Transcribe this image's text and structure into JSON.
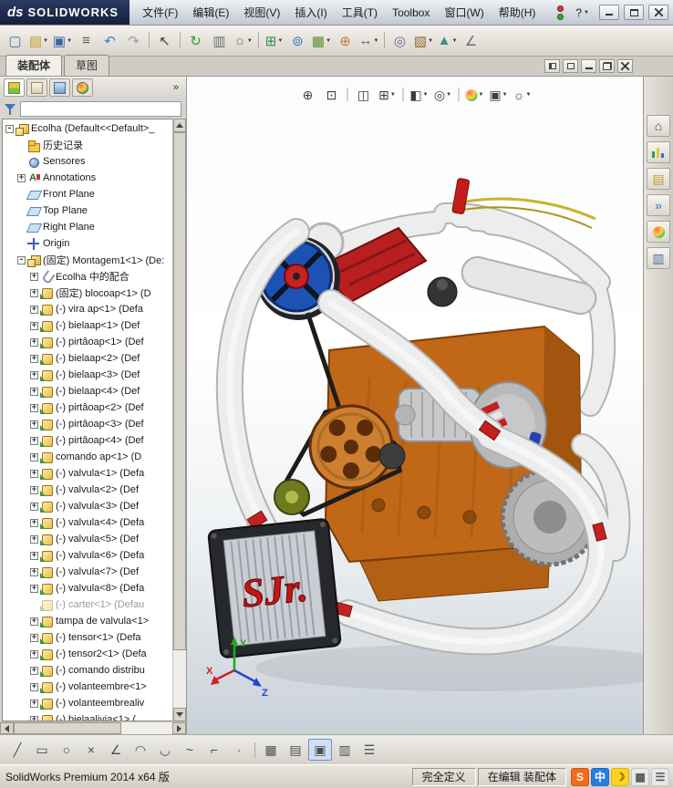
{
  "titlebar": {
    "logo_mark": "ds",
    "logo_text": "SOLIDWORKS",
    "menus": [
      "文件(F)",
      "编辑(E)",
      "视图(V)",
      "插入(I)",
      "工具(T)",
      "Toolbox",
      "窗口(W)",
      "帮助(H)"
    ],
    "help_label": "?"
  },
  "toolbar": {
    "items": [
      {
        "n": "new-icon",
        "g": "▢",
        "s": "color:#4a6fa5"
      },
      {
        "n": "open-icon",
        "g": "▤",
        "s": "color:#c89a2a",
        "caret": 1
      },
      {
        "n": "save-icon",
        "g": "▣",
        "s": "color:#3a62a8",
        "caret": 1
      },
      {
        "n": "print-icon",
        "g": "≡",
        "s": "color:#55585c"
      },
      {
        "n": "undo-icon",
        "g": "↶",
        "s": "color:#2f7fd0"
      },
      {
        "n": "redo-icon",
        "g": "↷",
        "s": "color:#9aa0a8"
      },
      {
        "sep": 1
      },
      {
        "n": "select-icon",
        "g": "↖",
        "s": "color:#3c3f44"
      },
      {
        "sep": 1
      },
      {
        "n": "rebuild-icon",
        "g": "↻",
        "s": "color:#2e9e3c"
      },
      {
        "n": "file-properties-icon",
        "g": "▥",
        "s": "color:#6a6d72"
      },
      {
        "n": "options-icon",
        "g": "☼",
        "s": "color:#707070",
        "caret": 1
      },
      {
        "sep": 1
      },
      {
        "n": "insert-components-icon",
        "g": "⊞",
        "s": "color:#2e8f46",
        "caret": 1
      },
      {
        "n": "mate-icon",
        "g": "⊚",
        "s": "color:#3a78c0"
      },
      {
        "n": "linear-pattern-icon",
        "g": "▦",
        "s": "color:#5d8f2e",
        "caret": 1
      },
      {
        "n": "smart-fasteners-icon",
        "g": "⊕",
        "s": "color:#c07f2e"
      },
      {
        "n": "move-component-icon",
        "g": "↔",
        "s": "color:#46648f",
        "caret": 1
      },
      {
        "sep": 1
      },
      {
        "n": "show-hidden-components-icon",
        "g": "◎",
        "s": "color:#7d5fa0"
      },
      {
        "n": "assembly-features-icon",
        "g": "▧",
        "s": "color:#8f6a2e",
        "caret": 1
      },
      {
        "n": "reference-geometry-icon",
        "g": "▲",
        "s": "color:#3f8f8a",
        "caret": 1
      },
      {
        "n": "measure-icon",
        "g": "∠",
        "s": "color:#6a6d72"
      }
    ]
  },
  "command_tabs": [
    {
      "label": "装配体",
      "active": 1
    },
    {
      "label": "草图"
    }
  ],
  "left_panel": {
    "manager_tabs": [
      {
        "name": "featuremanager-tab",
        "k": "fm",
        "active": 1
      },
      {
        "name": "propertymanager-tab",
        "k": "pm"
      },
      {
        "name": "configurationmanager-tab",
        "k": "cm"
      },
      {
        "name": "displaymanager-tab",
        "k": "dm"
      }
    ],
    "chevron": "»",
    "filter": {
      "value": ""
    },
    "tree": [
      {
        "label": "Ecolha (Default<<Default>_",
        "level": 0,
        "exp": "-",
        "icon": "asm"
      },
      {
        "label": "历史记录",
        "level": 1,
        "exp": "",
        "icon": "hist"
      },
      {
        "label": "Sensores",
        "level": 1,
        "exp": "",
        "icon": "sensor"
      },
      {
        "label": "Annotations",
        "level": 1,
        "exp": "+",
        "icon": "ann"
      },
      {
        "label": "Front Plane",
        "level": 1,
        "exp": "",
        "icon": "plane"
      },
      {
        "label": "Top Plane",
        "level": 1,
        "exp": "",
        "icon": "plane"
      },
      {
        "label": "Right Plane",
        "level": 1,
        "exp": "",
        "icon": "plane"
      },
      {
        "label": "Origin",
        "level": 1,
        "exp": "",
        "icon": "origin"
      },
      {
        "label": "(固定) Montagem1<1> (De:",
        "level": 1,
        "exp": "-",
        "icon": "asm"
      },
      {
        "label": "Ecolha 中的配合",
        "level": 2,
        "exp": "+",
        "icon": "mates"
      },
      {
        "label": "(固定) blocoap<1> (D",
        "level": 2,
        "exp": "+",
        "icon": "part"
      },
      {
        "label": "(-) vira ap<1> (Defa",
        "level": 2,
        "exp": "+",
        "icon": "part"
      },
      {
        "label": "(-) bielaap<1> (Def",
        "level": 2,
        "exp": "+",
        "icon": "part"
      },
      {
        "label": "(-) pirtâoap<1> (Def",
        "level": 2,
        "exp": "+",
        "icon": "part"
      },
      {
        "label": "(-) bielaap<2> (Def",
        "level": 2,
        "exp": "+",
        "icon": "part"
      },
      {
        "label": "(-) bielaap<3> (Def",
        "level": 2,
        "exp": "+",
        "icon": "part"
      },
      {
        "label": "(-) bielaap<4> (Def",
        "level": 2,
        "exp": "+",
        "icon": "part"
      },
      {
        "label": "(-) pirtâoap<2> (Def",
        "level": 2,
        "exp": "+",
        "icon": "part"
      },
      {
        "label": "(-) pirtâoap<3> (Def",
        "level": 2,
        "exp": "+",
        "icon": "part"
      },
      {
        "label": "(-) pirtâoap<4> (Def",
        "level": 2,
        "exp": "+",
        "icon": "part"
      },
      {
        "label": "comando ap<1> (D",
        "level": 2,
        "exp": "+",
        "icon": "part"
      },
      {
        "label": "(-) valvula<1> (Defa",
        "level": 2,
        "exp": "+",
        "icon": "part"
      },
      {
        "label": "(-) valvula<2> (Def",
        "level": 2,
        "exp": "+",
        "icon": "part"
      },
      {
        "label": "(-) valvula<3> (Def",
        "level": 2,
        "exp": "+",
        "icon": "part"
      },
      {
        "label": "(-) valvula<4> (Defa",
        "level": 2,
        "exp": "+",
        "icon": "part"
      },
      {
        "label": "(-) valvula<5> (Def",
        "level": 2,
        "exp": "+",
        "icon": "part"
      },
      {
        "label": "(-) valvula<6> (Defa",
        "level": 2,
        "exp": "+",
        "icon": "part"
      },
      {
        "label": "(-) valvula<7> (Def",
        "level": 2,
        "exp": "+",
        "icon": "part"
      },
      {
        "label": "(-) valvula<8> (Defa",
        "level": 2,
        "exp": "+",
        "icon": "part"
      },
      {
        "label": "(-) carter<1> (Defau",
        "level": 2,
        "exp": "",
        "icon": "part",
        "dim": 1
      },
      {
        "label": "tampa de valvula<1>",
        "level": 2,
        "exp": "+",
        "icon": "part"
      },
      {
        "label": "(-) tensor<1> (Defa",
        "level": 2,
        "exp": "+",
        "icon": "part"
      },
      {
        "label": "(-) tensor2<1> (Defa",
        "level": 2,
        "exp": "+",
        "icon": "part"
      },
      {
        "label": "(-) comando distribu",
        "level": 2,
        "exp": "+",
        "icon": "part"
      },
      {
        "label": "(-) volanteembre<1>",
        "level": 2,
        "exp": "+",
        "icon": "part"
      },
      {
        "label": "(-) volanteembrealiv",
        "level": 2,
        "exp": "+",
        "icon": "part"
      },
      {
        "label": "(-) bielaalivia<1> (",
        "level": 2,
        "exp": "+",
        "icon": "part"
      }
    ]
  },
  "viewport": {
    "headsup": [
      {
        "n": "zoom-fit-icon",
        "g": "⊕"
      },
      {
        "n": "zoom-area-icon",
        "g": "⊡"
      },
      {
        "sep": 1
      },
      {
        "n": "section-view-icon",
        "g": "◫"
      },
      {
        "n": "view-orientation-icon",
        "g": "⊞",
        "caret": 1
      },
      {
        "sep": 1
      },
      {
        "n": "display-style-icon",
        "g": "◧",
        "caret": 1
      },
      {
        "n": "hide-show-items-icon",
        "g": "◎",
        "caret": 1
      },
      {
        "sep": 1
      },
      {
        "n": "edit-appearance-icon",
        "ball": 1,
        "caret": 1
      },
      {
        "n": "apply-scene-icon",
        "g": "▣",
        "caret": 1
      },
      {
        "n": "view-settings-icon",
        "g": "☼",
        "caret": 1
      }
    ],
    "intercooler_text": "SJr.",
    "triad": {
      "x": "X",
      "y": "Y",
      "z": "Z"
    }
  },
  "taskpane": {
    "items": [
      {
        "n": "resources-icon",
        "g": "⌂",
        "s": "color:#2a4a8a"
      },
      {
        "n": "design-library-icon",
        "chart": 1
      },
      {
        "n": "file-explorer-icon",
        "g": "▤",
        "s": "color:#c89a2a"
      },
      {
        "n": "forum-icon",
        "g": "»",
        "s": "color:#2e6fd0"
      },
      {
        "n": "appearances-icon",
        "ball": 1
      },
      {
        "n": "custom-properties-icon",
        "g": "▥",
        "s": "color:#4a6fa5"
      }
    ]
  },
  "bottom_toolbar": {
    "items": [
      {
        "n": "sketch-line-icon",
        "g": "╱"
      },
      {
        "n": "sketch-rectangle-icon",
        "g": "▭"
      },
      {
        "n": "sketch-circle-icon",
        "g": "○"
      },
      {
        "n": "sketch-trim-icon",
        "g": "×"
      },
      {
        "n": "sketch-chamfer-icon",
        "g": "∠"
      },
      {
        "n": "sketch-arc-icon",
        "g": "◠"
      },
      {
        "n": "sketch-tangent-arc-icon",
        "g": "◡"
      },
      {
        "n": "sketch-spline-icon",
        "g": "~"
      },
      {
        "n": "sketch-corner-icon",
        "g": "⌐"
      },
      {
        "n": "sketch-point-icon",
        "g": "·"
      },
      {
        "sep": 1
      },
      {
        "n": "grid-icon",
        "g": "▦"
      },
      {
        "n": "snap-icon",
        "g": "▤"
      },
      {
        "n": "shaded-with-edges-icon",
        "g": "▣",
        "active": 1
      },
      {
        "n": "wireframe-icon",
        "g": "▥"
      },
      {
        "n": "section-list-icon",
        "g": "☰"
      }
    ]
  },
  "statusbar": {
    "product": "SolidWorks Premium 2014 x64 版",
    "define_state": "完全定义",
    "edit_state": "在编辑 装配体",
    "tray": [
      {
        "n": "sogou-icon",
        "g": "S",
        "s": "background:#f26a1a;color:#fff"
      },
      {
        "n": "ime-chinese-icon",
        "g": "中",
        "s": "background:#2a7de0;color:#fff"
      },
      {
        "n": "ime-skin-icon",
        "g": "☽",
        "s": "background:#ffd21e;color:#8a5a00"
      },
      {
        "n": "ime-keyboard-icon",
        "g": "▦",
        "s": "background:#e8e8e8;color:#555"
      },
      {
        "n": "ime-toolbox-icon",
        "g": "☰",
        "s": "background:#e8e8e8;color:#555"
      }
    ]
  },
  "palette": {
    "engine_orange": "#c06818",
    "pipe_white": "#ededed",
    "accent_red": "#c32222",
    "valve_cover_red": "#b82020",
    "pulley_blue": "#1d52b4",
    "viewport_bottom": "#c9d1d8"
  }
}
